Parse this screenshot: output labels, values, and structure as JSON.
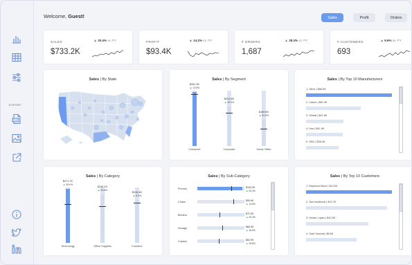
{
  "header": {
    "welcome_prefix": "Welcome, ",
    "welcome_name": "Guest!",
    "toggles": [
      {
        "label": "Sales",
        "active": true
      },
      {
        "label": "Profit",
        "active": false
      },
      {
        "label": "Orders",
        "active": false
      }
    ]
  },
  "sidebar": {
    "export_label": "EXPORT",
    "icons": [
      "bar-chart-icon",
      "table-icon",
      "sliders-icon",
      "pdf-export-icon",
      "image-export-icon",
      "external-link-icon",
      "info-icon",
      "twitter-icon",
      "linkedin-icon"
    ]
  },
  "kpis": [
    {
      "label": "SALES",
      "value": "$733.2K",
      "delta": "20.4%",
      "vs": "vs. PY"
    },
    {
      "label": "PROFIT",
      "value": "$93.4K",
      "delta": "14.2%",
      "vs": "vs. PY"
    },
    {
      "label": "# ORDERS",
      "value": "1,687",
      "delta": "28.3%",
      "vs": "vs. PY"
    },
    {
      "label": "# CUSTOMERS",
      "value": "693",
      "delta": "9.6%",
      "vs": "vs. PY"
    }
  ],
  "colors": {
    "accent": "#6b9bef",
    "track": "#dde5f2",
    "positive": "#2ea44f",
    "map_fill": "#d6e0ef",
    "map_dot": "#9bb8e8"
  },
  "charts": {
    "state": {
      "title_bold": "Sales",
      "title_rest": " | By State"
    },
    "segment": {
      "title_bold": "Sales",
      "title_rest": " | By Segment"
    },
    "manufacturers": {
      "title_bold": "Sales",
      "title_rest": " | By Top 10 Manufacturers"
    },
    "category": {
      "title_bold": "Sales",
      "title_rest": " | By Category"
    },
    "subcategory": {
      "title_bold": "Sales",
      "title_rest": " | By Sub-Category"
    },
    "customers": {
      "title_bold": "Sales",
      "title_rest": " | By Top 10 Customers"
    }
  },
  "chart_data": [
    {
      "type": "bar",
      "id": "segment",
      "categories": [
        "Consumer",
        "Corporate",
        "Home Office"
      ],
      "values": [
        331.9,
        241.8,
        159.5
      ],
      "value_labels": [
        "$331.9K",
        "$241.8K",
        "$159.5K"
      ],
      "deltas": [
        "13.6%",
        "19.0%",
        "51.5%"
      ],
      "prior_year": [
        320,
        205,
        105
      ],
      "ylim": [
        0,
        340
      ]
    },
    {
      "type": "bar",
      "id": "category",
      "categories": [
        "Technology",
        "Office Supplies",
        "Furniture"
      ],
      "values": [
        271.7,
        246.1,
        215.4
      ],
      "value_labels": [
        "$271.7K",
        "$246.1K",
        "$215.4K"
      ],
      "deltas": [
        "39.0%",
        "33.8%",
        "6.3%"
      ],
      "prior_year": [
        195,
        184,
        203
      ],
      "ylim": [
        0,
        280
      ]
    },
    {
      "type": "bar",
      "orientation": "horizontal",
      "id": "manufacturers",
      "categories": [
        "1. Other",
        "2. Canon",
        "3. Global",
        "4. Hon",
        "5. GBC"
      ],
      "values": [
        96.5,
        61.9,
        41.8,
        41.4,
        36.4
      ],
      "value_labels": [
        "$96.5K",
        "$61.9K",
        "$41.8K",
        "$41.4K",
        "$36.4K"
      ],
      "xlim": [
        0,
        100
      ]
    },
    {
      "type": "bar",
      "orientation": "horizontal",
      "id": "subcategory",
      "categories": [
        "Phones",
        "Chairs",
        "Binders",
        "Storage",
        "Copiers"
      ],
      "values": [
        105.3,
        95.6,
        72.9,
        68.3,
        62.9
      ],
      "value_labels": [
        "$105.3K",
        "$95.6K",
        "$72.9K",
        "$68.3K",
        "$62.9K"
      ],
      "deltas": [
        "32.4%",
        "13.8%",
        "40.3%",
        "18.5%",
        "26.8%"
      ],
      "prior_year": [
        80,
        84,
        52,
        58,
        50
      ],
      "xlim": [
        0,
        110
      ]
    },
    {
      "type": "bar",
      "orientation": "horizontal",
      "id": "customers",
      "categories": [
        "1. Raymond Buch",
        "2. Tom Ashbrook",
        "3. Hunter Lopez",
        "4. Todd Sumrall"
      ],
      "values": [
        14.5,
        13.7,
        10.5,
        8.5
      ],
      "value_labels": [
        "$14.5K",
        "$13.7K",
        "$10.5K",
        "$8.5K"
      ],
      "xlim": [
        0,
        15
      ]
    }
  ]
}
